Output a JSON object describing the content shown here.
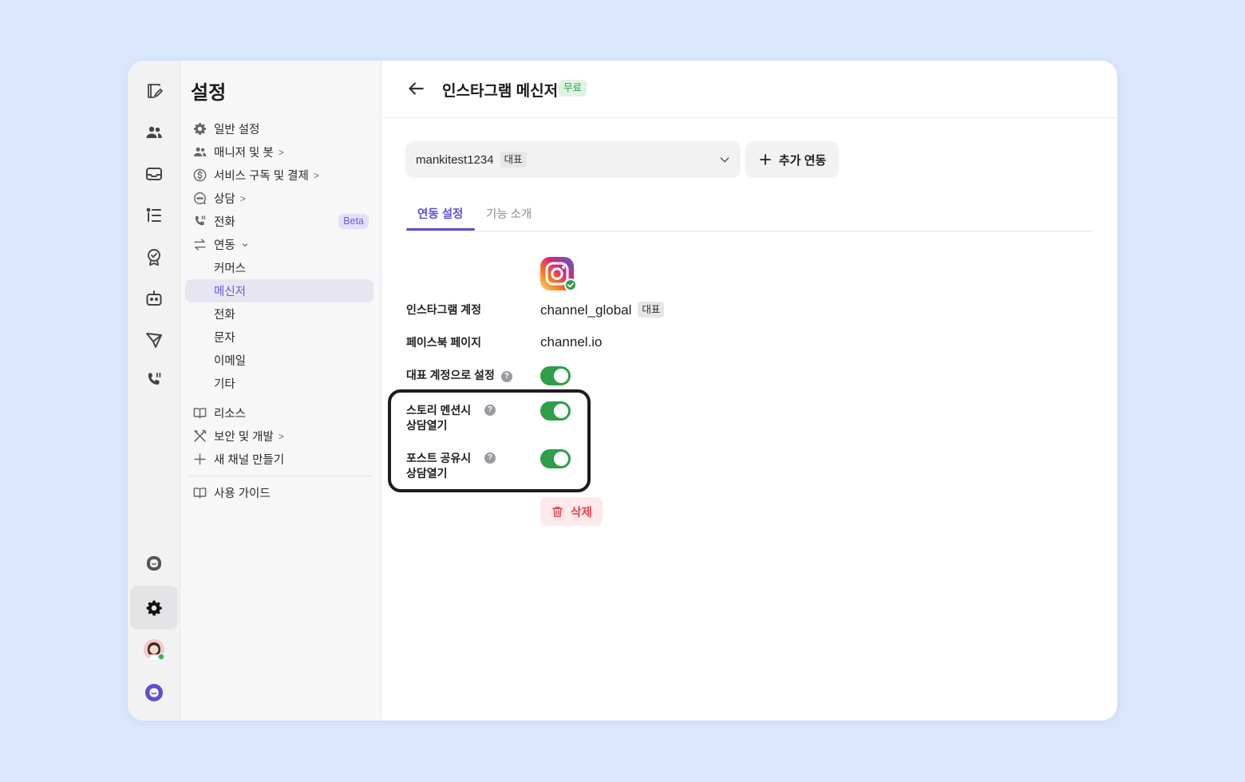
{
  "colors": {
    "background": "#d9e6fc",
    "accent": "#5b4fd6",
    "toggle_on": "#2e9e48",
    "danger": "#e0454f",
    "free_badge": "#2f9e4a"
  },
  "rail": {
    "icons": [
      "inbox-edit-icon",
      "contacts-icon",
      "inbox-tray-icon",
      "list-icon",
      "badge-icon",
      "bot-icon",
      "send-icon",
      "phone-icon",
      "channel-talk-icon",
      "gear-icon",
      "avatar",
      "channel-logo-icon"
    ]
  },
  "sidebar": {
    "title": "설정",
    "items": {
      "general": "일반 설정",
      "managers": "매니저 및 봇",
      "billing": "서비스 구독 및 결제",
      "consult": "상담",
      "call": "전화",
      "call_badge": "Beta",
      "integration": "연동",
      "commerce": "커머스",
      "messenger": "메신저",
      "call_sub": "전화",
      "sms": "문자",
      "email": "이메일",
      "etc": "기타",
      "resources": "리소스",
      "security": "보안 및 개발",
      "new_channel": "새 채널 만들기",
      "guide": "사용 가이드"
    },
    "chevron": ">",
    "chevron_down": "⌄"
  },
  "header": {
    "title": "인스타그램 메신저",
    "badge": "무료"
  },
  "account_select": {
    "value": "mankitest1234",
    "tag": "대표"
  },
  "add_button": {
    "label": "추가 연동"
  },
  "tabs": {
    "settings": "연동 설정",
    "intro": "기능 소개"
  },
  "settings": {
    "instagram_account_label": "인스타그램 계정",
    "instagram_account_value": "channel_global",
    "instagram_account_tag": "대표",
    "facebook_page_label": "페이스북 페이지",
    "facebook_page_value": "channel.io",
    "primary_label": "대표 계정으로 설정",
    "primary_on": true,
    "story_label_1": "스토리 멘션시",
    "story_label_2": "상담열기",
    "story_on": true,
    "post_label_1": "포스트 공유시",
    "post_label_2": "상담열기",
    "post_on": true,
    "help_symbol": "?"
  },
  "delete_button": {
    "label": "삭제"
  }
}
